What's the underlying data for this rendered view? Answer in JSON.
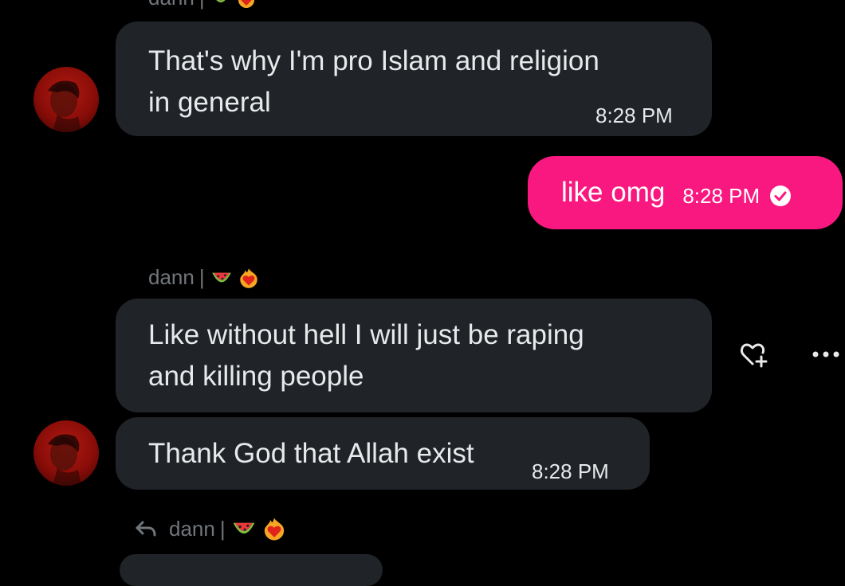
{
  "conversation": {
    "sender_name": "dann",
    "sender_separator": "|",
    "sender_emojis": [
      "watermelon-icon",
      "heart-on-fire-icon"
    ],
    "messages": [
      {
        "direction": "incoming",
        "text_line1": "That's why I'm pro Islam and religion",
        "text_line2": "in general",
        "time": "8:28 PM"
      },
      {
        "direction": "outgoing",
        "text": "like omg",
        "time": "8:28 PM",
        "status_icon": "check-circle-icon"
      },
      {
        "direction": "incoming",
        "text_line1": "Like without hell I will just be raping",
        "text_line2": "and killing people"
      },
      {
        "direction": "incoming",
        "text": "Thank God that Allah exist",
        "time": "8:28 PM"
      }
    ],
    "actions": {
      "react_icon": "heart-plus-icon",
      "more_icon": "more-options-icon"
    },
    "reply_header": {
      "icon": "reply-arrow-icon",
      "name": "dann",
      "separator": "|"
    }
  },
  "colors": {
    "background": "#000000",
    "incoming_bubble": "#202327",
    "outgoing_bubble": "#f91880",
    "muted_text": "#71767b"
  }
}
